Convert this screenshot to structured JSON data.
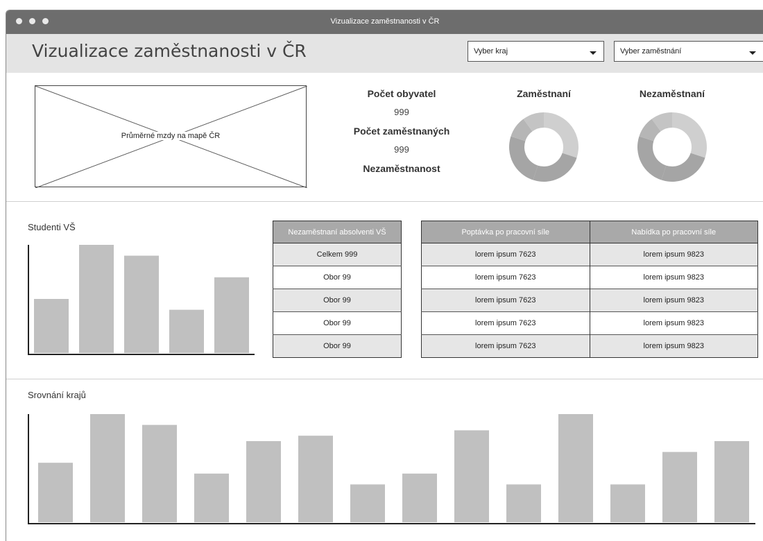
{
  "window": {
    "title": "Vizualizace zaměstnanosti v ČR"
  },
  "header": {
    "title": "Vizualizace zaměstnanosti v ČR",
    "region_select": "Vyber kraj",
    "occupation_select": "Vyber zaměstnání"
  },
  "map": {
    "label": "Průměrné mzdy na mapě ČR"
  },
  "stats": {
    "population_label": "Počet obyvatel",
    "population_value": "999",
    "employed_label": "Počet zaměstnaných",
    "employed_value": "999",
    "unemployment_label": "Nezaměstnanost"
  },
  "donuts": {
    "employed_title": "Zaměstnaní",
    "unemployed_title": "Nezaměstnaní",
    "colors": [
      "#cfcfcf",
      "#a5a5a5",
      "#b6b6b6",
      "#c4c4c4"
    ]
  },
  "students": {
    "label": "Studenti VŠ"
  },
  "graduates_table": {
    "header": "Nezaměstnaní absolventi VŠ",
    "rows": [
      "Celkem 999",
      "Obor 99",
      "Obor 99",
      "Obor 99",
      "Obor 99"
    ]
  },
  "labor_table": {
    "headers": [
      "Poptávka po pracovní síle",
      "Nabídka po pracovní síle"
    ],
    "rows": [
      [
        "lorem ipsum 7623",
        "lorem ipsum 9823"
      ],
      [
        "lorem ipsum 7623",
        "lorem ipsum 9823"
      ],
      [
        "lorem ipsum 7623",
        "lorem ipsum 9823"
      ],
      [
        "lorem ipsum 7623",
        "lorem ipsum 9823"
      ],
      [
        "lorem ipsum 7623",
        "lorem ipsum 9823"
      ]
    ]
  },
  "regions": {
    "label": "Srovnání krajů"
  },
  "chart_data": [
    {
      "type": "bar",
      "title": "Studenti VŠ",
      "values": [
        50,
        100,
        90,
        40,
        70
      ],
      "ylim": [
        0,
        100
      ]
    },
    {
      "type": "bar",
      "title": "Srovnání krajů",
      "values": [
        55,
        100,
        90,
        45,
        75,
        80,
        35,
        45,
        85,
        35,
        100,
        35,
        65,
        75
      ],
      "ylim": [
        0,
        100
      ]
    },
    {
      "type": "pie",
      "title": "Zaměstnaní",
      "values": [
        30,
        25,
        25,
        10,
        10
      ]
    },
    {
      "type": "pie",
      "title": "Nezaměstnaní",
      "values": [
        30,
        25,
        25,
        10,
        10
      ]
    }
  ]
}
